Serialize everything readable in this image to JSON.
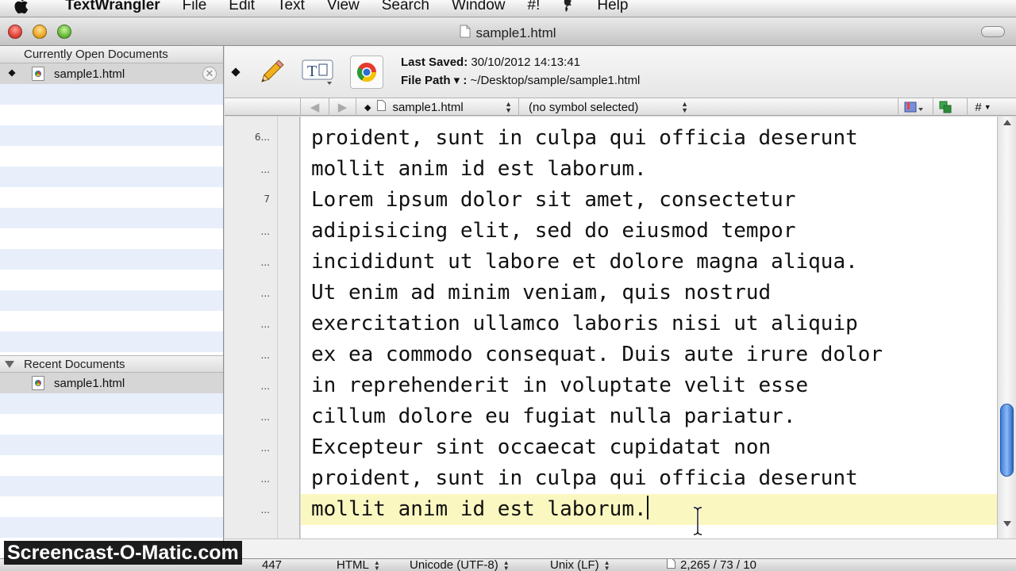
{
  "menubar": {
    "app_name": "TextWrangler",
    "items": [
      "File",
      "Edit",
      "Text",
      "View",
      "Search",
      "Window",
      "#!"
    ],
    "help": "Help"
  },
  "window": {
    "title": "sample1.html"
  },
  "sidebar": {
    "open_header": "Currently Open Documents",
    "open_docs": [
      {
        "name": "sample1.html"
      }
    ],
    "recent_header": "Recent Documents",
    "recent_docs": [
      {
        "name": "sample1.html"
      }
    ]
  },
  "info": {
    "last_saved_label": "Last Saved:",
    "last_saved_value": "30/10/2012 14:13:41",
    "file_path_label": "File Path ▾ :",
    "file_path_value": "~/Desktop/sample/sample1.html"
  },
  "navbar": {
    "document": "sample1.html",
    "symbol": "(no symbol selected)",
    "hash": "#"
  },
  "gutter": {
    "labels": [
      "6...",
      "...",
      "7",
      "...",
      "...",
      "...",
      "...",
      "...",
      "...",
      "...",
      "...",
      "...",
      "..."
    ]
  },
  "editor": {
    "lines": [
      "proident, sunt in culpa qui officia deserunt",
      "mollit anim id est laborum.",
      "Lorem ipsum dolor sit amet, consectetur",
      "adipisicing elit, sed do eiusmod tempor",
      "incididunt ut labore et dolore magna aliqua.",
      "Ut enim ad minim veniam, quis nostrud",
      "exercitation ullamco laboris nisi ut aliquip",
      "ex ea commodo consequat. Duis aute irure dolor",
      "in reprehenderit in voluptate velit esse",
      "cillum dolore eu fugiat nulla pariatur.",
      "Excepteur sint occaecat cupidatat non",
      "proident, sunt in culpa qui officia deserunt",
      "mollit anim id est laborum."
    ],
    "current_line_color": "#fbf7c0"
  },
  "statusbar": {
    "position": "447",
    "language": "HTML",
    "encoding": "Unicode (UTF-8)",
    "line_endings": "Unix (LF)",
    "stats": "2,265 / 73 / 10"
  },
  "watermark": "Screencast-O-Matic.com",
  "colors": {
    "accent": "#3b7fdc",
    "close": "#e0443a",
    "minimize": "#e9a824",
    "zoom": "#6ab93a"
  }
}
